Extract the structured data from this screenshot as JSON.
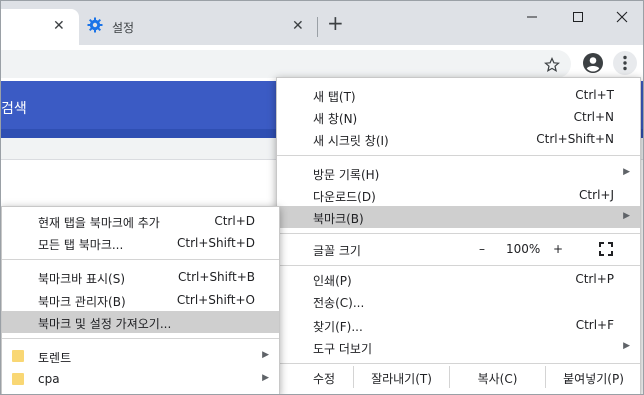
{
  "tabs": [
    {
      "title": "",
      "close": "✕"
    },
    {
      "title": "설정",
      "close": "✕",
      "icon": "gear-icon"
    }
  ],
  "new_tab": "+",
  "page": {
    "header_text": "검색"
  },
  "main_menu": {
    "items": [
      {
        "label": "새 탭(T)",
        "shortcut": "Ctrl+T"
      },
      {
        "label": "새 창(N)",
        "shortcut": "Ctrl+N"
      },
      {
        "label": "새 시크릿 창(I)",
        "shortcut": "Ctrl+Shift+N"
      },
      {
        "label": "방문 기록(H)",
        "shortcut": ""
      },
      {
        "label": "다운로드(D)",
        "shortcut": "Ctrl+J"
      },
      {
        "label": "북마크(B)",
        "shortcut": ""
      },
      {
        "label": "글꼴 크기",
        "shortcut": ""
      },
      {
        "label": "인쇄(P)",
        "shortcut": "Ctrl+P"
      },
      {
        "label": "전송(C)...",
        "shortcut": ""
      },
      {
        "label": "찾기(F)...",
        "shortcut": "Ctrl+F"
      },
      {
        "label": "도구 더보기",
        "shortcut": ""
      }
    ],
    "zoom": {
      "minus": "–",
      "value": "100%",
      "plus": "+"
    },
    "edit": {
      "label": "수정",
      "cut": "잘라내기(T)",
      "copy": "복사(C)",
      "paste": "붙여넣기(P)"
    }
  },
  "bookmark_menu": {
    "items": [
      {
        "label": "현재 탭을 북마크에 추가",
        "shortcut": "Ctrl+D"
      },
      {
        "label": "모든 탭 북마크...",
        "shortcut": "Ctrl+Shift+D"
      },
      {
        "label": "북마크바 표시(S)",
        "shortcut": "Ctrl+Shift+B"
      },
      {
        "label": "북마크 관리자(B)",
        "shortcut": "Ctrl+Shift+O"
      },
      {
        "label": "북마크 및 설정 가져오기...",
        "shortcut": ""
      },
      {
        "label": "토렌트",
        "shortcut": ""
      },
      {
        "label": "cpa",
        "shortcut": ""
      }
    ]
  },
  "colors": {
    "highlight": "#cfcfcf",
    "page_blue": "#3b5bc4",
    "folder": "#f9d774"
  }
}
